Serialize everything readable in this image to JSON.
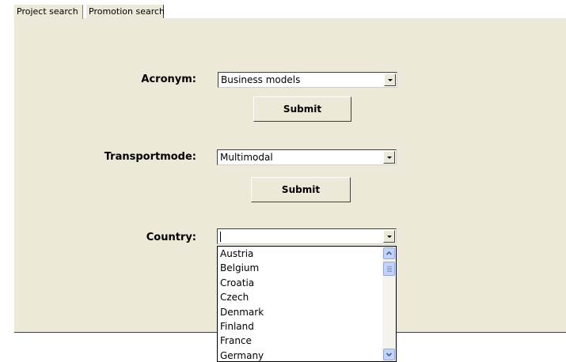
{
  "tabs": [
    {
      "label": "Project search",
      "active": true
    },
    {
      "label": "Promotion search",
      "active": false
    }
  ],
  "acronym": {
    "label": "Acronym:",
    "selected": "Business models",
    "submit": "Submit"
  },
  "transportmode": {
    "label": "Transportmode:",
    "selected": "Multimodal",
    "submit": "Submit"
  },
  "country": {
    "label": "Country:",
    "selected": "",
    "options": [
      "Austria",
      "Belgium",
      "Croatia",
      "Czech",
      "Denmark",
      "Finland",
      "France",
      "Germany"
    ]
  },
  "icons": {
    "dropdown": "chevron-down-icon",
    "scroll_up": "scroll-up-icon",
    "scroll_down": "scroll-down-icon"
  },
  "colors": {
    "panel_bg": "#ece9d8",
    "scroll_accent": "#c1d3fb"
  }
}
